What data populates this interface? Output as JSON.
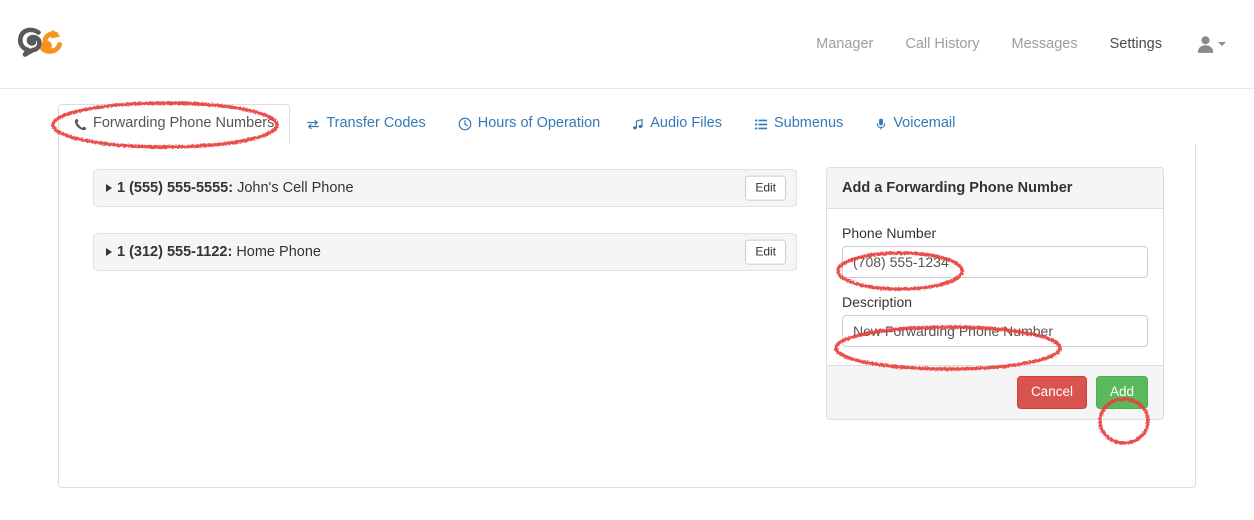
{
  "header": {
    "logo_icon": "cs-cycle-logo",
    "nav": [
      {
        "label": "Manager",
        "active": false
      },
      {
        "label": "Call History",
        "active": false
      },
      {
        "label": "Messages",
        "active": false
      },
      {
        "label": "Settings",
        "active": true
      }
    ],
    "user_menu": {
      "icon": "user-icon",
      "caret_icon": "caret-down-icon"
    }
  },
  "loading_bar": {
    "color": "#fd7e14"
  },
  "tabs": [
    {
      "label": "Forwarding Phone Numbers",
      "icon": "phone-icon",
      "active": true
    },
    {
      "label": "Transfer Codes",
      "icon": "transfer-icon",
      "active": false
    },
    {
      "label": "Hours of Operation",
      "icon": "clock-icon",
      "active": false
    },
    {
      "label": "Audio Files",
      "icon": "music-note-icon",
      "active": false
    },
    {
      "label": "Submenus",
      "icon": "list-icon",
      "active": false
    },
    {
      "label": "Voicemail",
      "icon": "microphone-icon",
      "active": false
    }
  ],
  "forwarding_numbers": [
    {
      "number": "1 (555) 555-5555:",
      "description": "John's Cell Phone",
      "edit_label": "Edit"
    },
    {
      "number": "1 (312) 555-1122:",
      "description": "Home Phone",
      "edit_label": "Edit"
    }
  ],
  "add_panel": {
    "title": "Add a Forwarding Phone Number",
    "phone_label": "Phone Number",
    "phone_value": "(708) 555-1234",
    "phone_placeholder": "Phone Number",
    "description_label": "Description",
    "description_value": "New Forwarding Phone Number",
    "description_placeholder": "Description",
    "cancel_label": "Cancel",
    "add_label": "Add"
  },
  "colors": {
    "accent_orange": "#fd7e14",
    "link_blue": "#337ab7",
    "danger_red": "#d9534f",
    "success_green": "#5cb85c",
    "annotation_red": "#e8403a"
  }
}
